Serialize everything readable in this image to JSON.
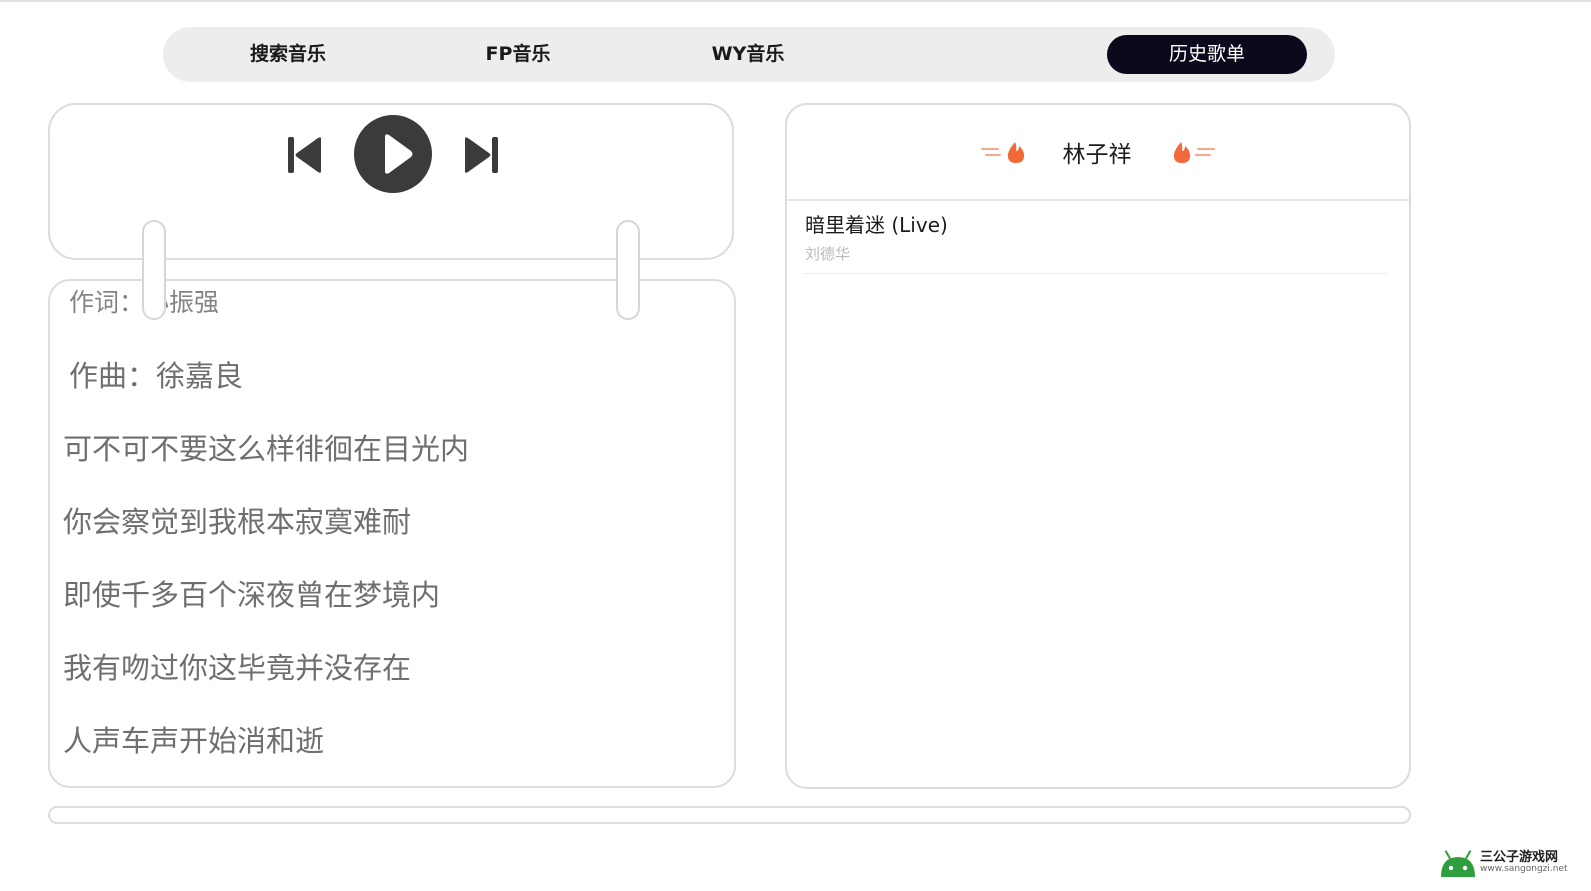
{
  "nav": {
    "tabs": [
      {
        "label": "搜索音乐"
      },
      {
        "label": "FP音乐"
      },
      {
        "label": "WY音乐"
      },
      {
        "label": "历史歌单"
      }
    ],
    "active": "历史歌单"
  },
  "player": {
    "prev_icon": "skip-previous-icon",
    "play_icon": "play-icon",
    "next_icon": "skip-next-icon"
  },
  "lyrics": {
    "lines": [
      "作词：小振强",
      "作曲：徐嘉良",
      "可不可不要这么样徘徊在目光内",
      "你会察觉到我根本寂寞难耐",
      "即使千多百个深夜曾在梦境内",
      "我有吻过你这毕竟并没存在",
      "人声车声开始消和逝"
    ]
  },
  "playlist": {
    "title": "林子祥",
    "songs": [
      {
        "title": "暗里着迷 (Live)",
        "artist": "刘德华"
      }
    ]
  },
  "watermark": {
    "title": "三公子游戏网",
    "url": "www.sangongzi.net"
  },
  "colors": {
    "active_tab_bg": "#0a0a1c",
    "nav_bg": "#eceeed",
    "flame": "#f26a3a",
    "lyric_text": "#6f6f6f"
  }
}
